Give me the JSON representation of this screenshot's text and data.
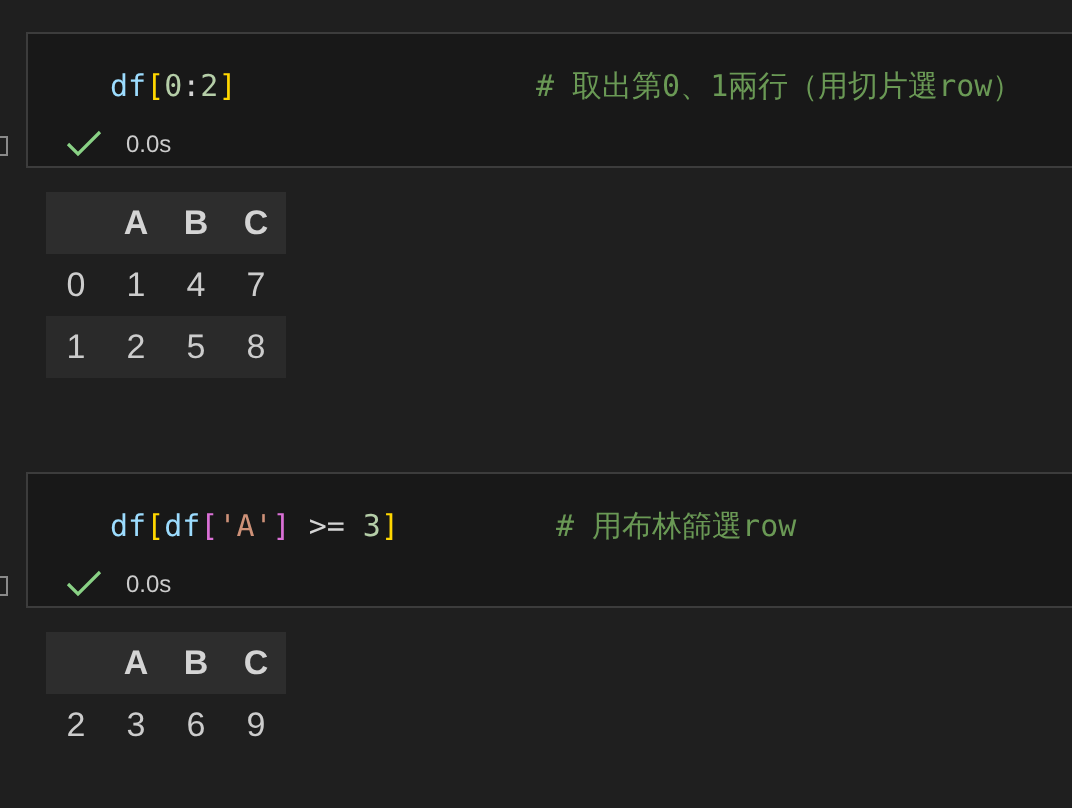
{
  "cells": [
    {
      "code": [
        {
          "kind": "name",
          "text": "df"
        },
        {
          "kind": "bracket",
          "text": "["
        },
        {
          "kind": "number",
          "text": "0"
        },
        {
          "kind": "plain",
          "text": ":"
        },
        {
          "kind": "number",
          "text": "2"
        },
        {
          "kind": "bracket",
          "text": "]"
        }
      ],
      "comment": "# 取出第0、1兩行（用切片選row）",
      "succeeded": true,
      "duration": "0.0s",
      "table": {
        "columns": [
          "",
          "A",
          "B",
          "C"
        ],
        "rows": [
          [
            "0",
            "1",
            "4",
            "7"
          ],
          [
            "1",
            "2",
            "5",
            "8"
          ]
        ]
      }
    },
    {
      "code": [
        {
          "kind": "name",
          "text": "df"
        },
        {
          "kind": "bracket",
          "text": "["
        },
        {
          "kind": "name",
          "text": "df"
        },
        {
          "kind": "bracket2",
          "text": "["
        },
        {
          "kind": "string",
          "text": "'A'"
        },
        {
          "kind": "bracket2",
          "text": "]"
        },
        {
          "kind": "operator",
          "text": ">="
        },
        {
          "kind": "number",
          "text": "3"
        },
        {
          "kind": "bracket",
          "text": "]"
        }
      ],
      "comment": "# 用布林篩選row",
      "succeeded": true,
      "duration": "0.0s",
      "table": {
        "columns": [
          "",
          "A",
          "B",
          "C"
        ],
        "rows": [
          [
            "2",
            "3",
            "6",
            "9"
          ]
        ]
      }
    }
  ]
}
